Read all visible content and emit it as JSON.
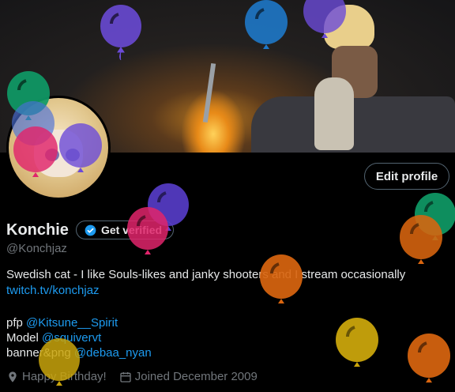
{
  "profile": {
    "display_name": "Konchie",
    "handle": "@Konchjaz",
    "edit_profile_label": "Edit profile",
    "get_verified_label": "Get verified",
    "bio": {
      "line1": "Swedish cat - I like Souls-likes and janky shooters and I stream occasionally",
      "link1": "twitch.tv/konchjaz",
      "pfp_prefix": "pfp ",
      "pfp_handle": "@Kitsune__Spirit",
      "model_prefix": "Model ",
      "model_handle": "@squivervt",
      "banner_prefix": "banner&png ",
      "banner_handle": "@debaa_nyan"
    },
    "birthday": "Happy Birthday!",
    "joined": "Joined December 2009"
  },
  "icons": {
    "verified": "verified-badge-icon",
    "birthday": "location-pin-icon",
    "joined": "calendar-icon"
  },
  "colors": {
    "accent": "#1d9bf0",
    "text": "#e7e9ea",
    "muted": "#71767b",
    "border": "#536471"
  }
}
